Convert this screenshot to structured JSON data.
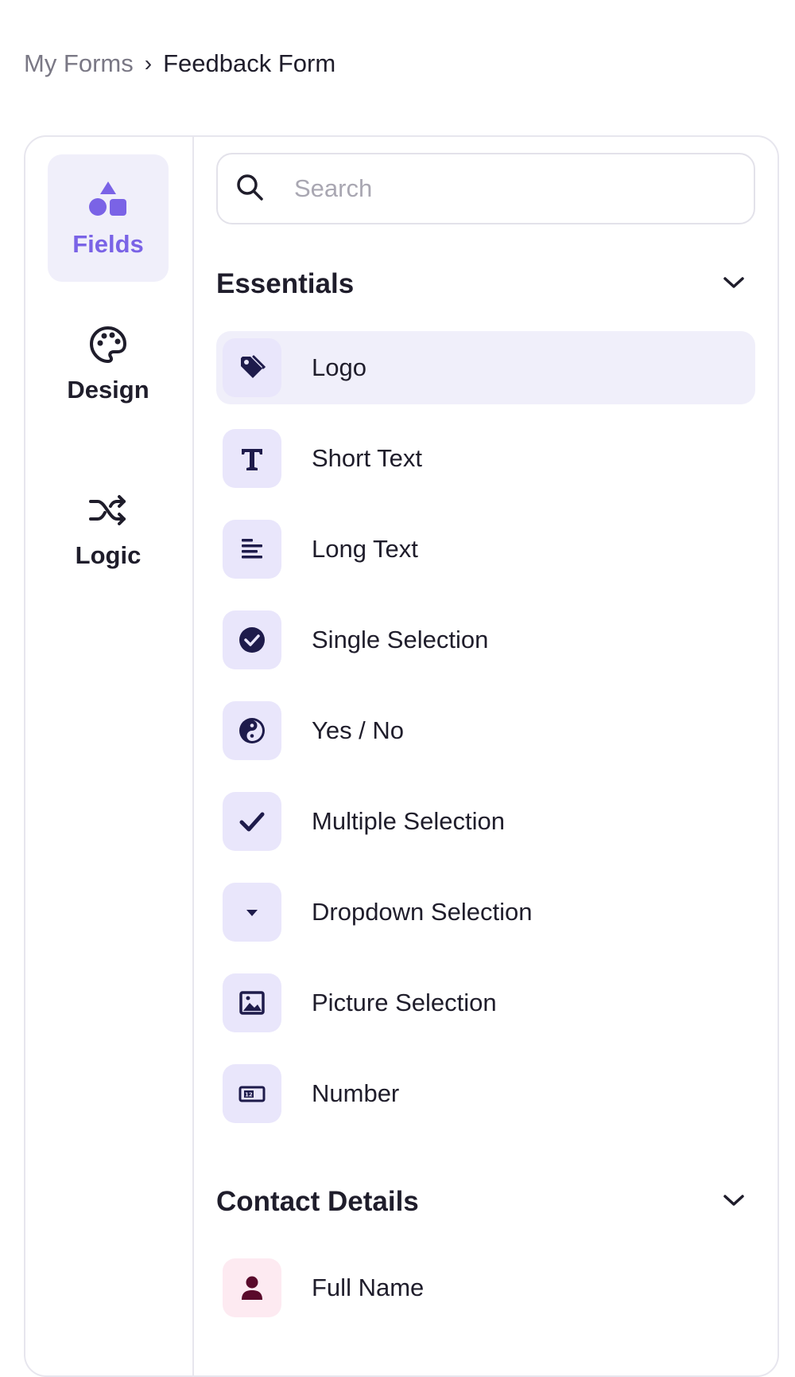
{
  "breadcrumb": {
    "parent": "My Forms",
    "separator": "›",
    "current": "Feedback Form"
  },
  "rail": {
    "fields_label": "Fields",
    "design_label": "Design",
    "logic_label": "Logic"
  },
  "search": {
    "placeholder": "Search",
    "value": ""
  },
  "sections": {
    "essentials": {
      "title": "Essentials",
      "items": [
        {
          "label": "Logo",
          "icon": "tag-icon"
        },
        {
          "label": "Short Text",
          "icon": "text-t-icon"
        },
        {
          "label": "Long Text",
          "icon": "paragraph-icon"
        },
        {
          "label": "Single Selection",
          "icon": "check-circle-icon"
        },
        {
          "label": "Yes / No",
          "icon": "yin-yang-icon"
        },
        {
          "label": "Multiple Selection",
          "icon": "checkmark-icon"
        },
        {
          "label": "Dropdown Selection",
          "icon": "caret-down-icon"
        },
        {
          "label": "Picture Selection",
          "icon": "image-icon"
        },
        {
          "label": "Number",
          "icon": "number-icon"
        }
      ]
    },
    "contact": {
      "title": "Contact Details",
      "items": [
        {
          "label": "Full Name",
          "icon": "person-icon"
        }
      ]
    }
  },
  "colors": {
    "accent": "#7a63e6",
    "icon_bg": "#e9e6fb",
    "icon_fg": "#1e1b4b",
    "contact_icon_bg": "#fdeaf1",
    "contact_icon_fg": "#5a0a2b"
  }
}
